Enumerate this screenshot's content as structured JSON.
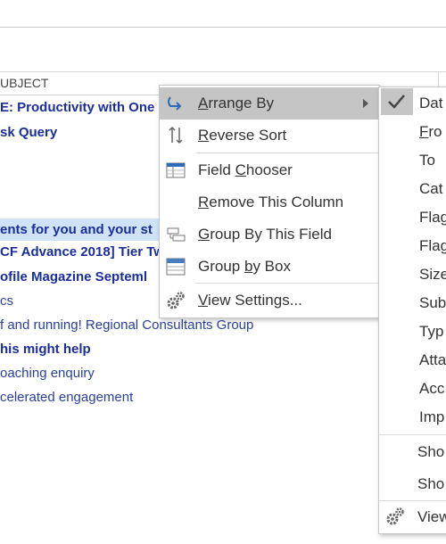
{
  "column_header": {
    "label": "UBJECT"
  },
  "emails": [
    {
      "subject": "E: Productivity with One",
      "style": "unread",
      "selected": false
    },
    {
      "subject": "sk Query",
      "style": "unread",
      "selected": false
    },
    {
      "subject": "ents for you and your st",
      "style": "unread",
      "selected": true
    },
    {
      "subject": "CF Advance 2018] Tier Tw",
      "style": "unread",
      "selected": false
    },
    {
      "subject": "ofile Magazine Septeml",
      "style": "unread",
      "selected": false
    },
    {
      "subject": "cs",
      "style": "read",
      "selected": false
    },
    {
      "subject": "f and running! Regional Consultants Group",
      "style": "read",
      "selected": false
    },
    {
      "subject": "his might help",
      "style": "unread",
      "selected": false
    },
    {
      "subject": "oaching enquiry",
      "style": "read",
      "selected": false
    },
    {
      "subject": "celerated engagement",
      "style": "read",
      "selected": false
    }
  ],
  "context_menu": {
    "arrange_by": {
      "key": "A",
      "rest": "rrange By",
      "icon": "arrange-by-icon"
    },
    "reverse_sort": {
      "key": "R",
      "rest": "everse Sort",
      "icon": "reverse-sort-icon"
    },
    "field_chooser": {
      "pre": "Field ",
      "key": "C",
      "rest": "hooser",
      "icon": "field-chooser-icon"
    },
    "remove_column": {
      "key": "R",
      "rest": "emove This Column"
    },
    "group_by_field": {
      "key": "G",
      "rest": "roup By This Field",
      "icon": "group-by-field-icon"
    },
    "group_by_box": {
      "pre": "Group ",
      "key": "b",
      "rest": "y Box",
      "icon": "group-by-box-icon"
    },
    "view_settings": {
      "key": "V",
      "rest": "iew Settings...",
      "icon": "view-settings-icon"
    }
  },
  "submenu": {
    "items": [
      "Dat",
      "Fro",
      "To",
      "Cat",
      "Flag",
      "Flag",
      "Size",
      "Sub",
      "Typ",
      "Atta",
      "Acc",
      "Imp"
    ],
    "underline_index": [
      0,
      1,
      0,
      0,
      0,
      0,
      0,
      0,
      0,
      0,
      0,
      0
    ],
    "extra": [
      "Sho",
      "Sho",
      "View"
    ]
  },
  "colors": {
    "accent": "#2e6ab8",
    "highlight": "#c5c5c5",
    "unread_text": "#1a2e9b"
  }
}
